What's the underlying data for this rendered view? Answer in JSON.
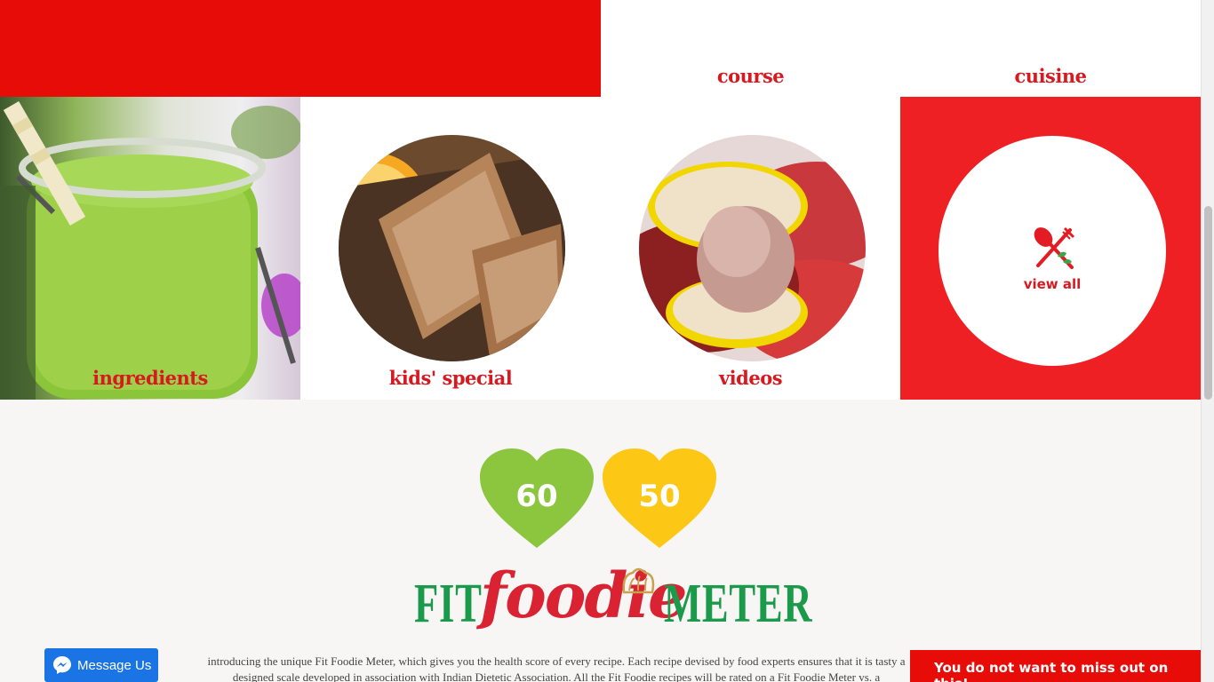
{
  "tiles": {
    "course": "course",
    "cuisine": "cuisine",
    "ingredients": "ingredients",
    "kids_special": "kids' special",
    "videos": "videos",
    "view_all": "view all"
  },
  "meter": {
    "green_score": "60",
    "yellow_score": "50",
    "logo_fit": "FIT",
    "logo_foodie": "foodie",
    "logo_meter": "METER",
    "intro_line1": "introducing the unique Fit Foodie Meter, which gives you the health score of every recipe. Each recipe devised by food experts ensures that it is tasty a",
    "intro_line2": "designed scale developed in association with Indian Dietetic Association. All the Fit Foodie recipes will be rated on a Fit Foodie Meter vs. a"
  },
  "floating": {
    "messenger_label": "Message Us",
    "promo_label": "You do not want to miss out on this!"
  },
  "colors": {
    "brand_red": "#e80c09",
    "label_red": "#d71920",
    "heart_green": "#8cc63f",
    "heart_yellow": "#fcc715",
    "logo_green": "#1a9a4a",
    "messenger_blue": "#1b74e4"
  }
}
